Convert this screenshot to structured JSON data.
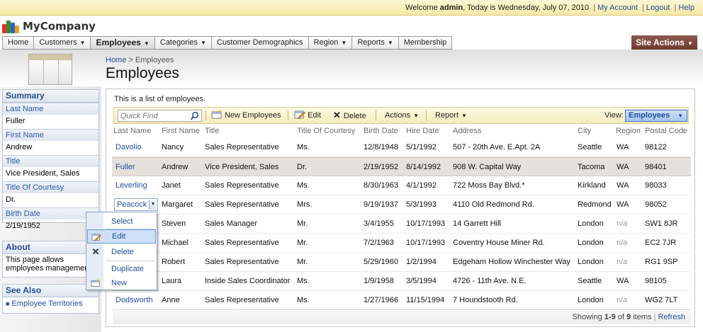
{
  "topbar": {
    "welcome_prefix": "Welcome",
    "user": "admin",
    "today_text": ", Today is Wednesday, July 07, 2010",
    "my_account": "My Account",
    "logout": "Logout",
    "help": "Help"
  },
  "brand": {
    "name": "MyCompany"
  },
  "menu": {
    "items": [
      {
        "label": "Home"
      },
      {
        "label": "Customers"
      },
      {
        "label": "Employees"
      },
      {
        "label": "Categories"
      },
      {
        "label": "Customer Demographics"
      },
      {
        "label": "Region"
      },
      {
        "label": "Reports"
      },
      {
        "label": "Membership"
      }
    ],
    "site_actions": "Site Actions"
  },
  "breadcrumb": {
    "home": "Home",
    "separator": ">",
    "current": "Employees"
  },
  "page": {
    "title": "Employees",
    "description": "This is a list of employees."
  },
  "summary": {
    "title": "Summary",
    "fields": [
      {
        "label": "Last Name",
        "value": "Fuller"
      },
      {
        "label": "First Name",
        "value": "Andrew"
      },
      {
        "label": "Title",
        "value": "Vice President, Sales"
      },
      {
        "label": "Title Of Courtesy",
        "value": "Dr."
      },
      {
        "label": "Birth Date",
        "value": "2/19/1952"
      }
    ]
  },
  "about": {
    "title": "About",
    "text1": "This page allows",
    "text2": "employees management"
  },
  "see_also": {
    "title": "See Also",
    "link": "Employee Territories"
  },
  "toolbar": {
    "quick_find_placeholder": "Quick Find",
    "new_label": "New Employees",
    "edit_label": "Edit",
    "delete_label": "Delete",
    "actions_label": "Actions",
    "report_label": "Report",
    "view_label": "View:",
    "view_value": "Employees"
  },
  "grid": {
    "columns": [
      "Last Name",
      "First Name",
      "Title",
      "Title Of Courtesy",
      "Birth Date",
      "Hire Date",
      "Address",
      "City",
      "Region",
      "Postal Code"
    ],
    "rows": [
      [
        "Davolio",
        "Nancy",
        "Sales Representative",
        "Ms.",
        "12/8/1948",
        "5/1/1992",
        "507 - 20th Ave. E.Apt. 2A",
        "Seattle",
        "WA",
        "98122"
      ],
      [
        "Fuller",
        "Andrew",
        "Vice President, Sales",
        "Dr.",
        "2/19/1952",
        "8/14/1992",
        "908 W. Capital Way",
        "Tacoma",
        "WA",
        "98401"
      ],
      [
        "Leverling",
        "Janet",
        "Sales Representative",
        "Ms.",
        "8/30/1963",
        "4/1/1992",
        "722 Moss Bay Blvd.*",
        "Kirkland",
        "WA",
        "98033"
      ],
      [
        "Peacock",
        "Margaret",
        "Sales Representative",
        "Mrs.",
        "9/19/1937",
        "5/3/1993",
        "4110 Old Redmond Rd.",
        "Redmond",
        "WA",
        "98052"
      ],
      [
        "",
        "Steven",
        "Sales Manager",
        "Mr.",
        "3/4/1955",
        "10/17/1993",
        "14 Garrett Hill",
        "London",
        "n/a",
        "SW1 8JR"
      ],
      [
        "",
        "Michael",
        "Sales Representative",
        "Mr.",
        "7/2/1963",
        "10/17/1993",
        "Coventry House Miner Rd.",
        "London",
        "n/a",
        "EC2 7JR"
      ],
      [
        "",
        "Robert",
        "Sales Representative",
        "Mr.",
        "5/29/1960",
        "1/2/1994",
        "Edgeham Hollow Winchester Way",
        "London",
        "n/a",
        "RG1 9SP"
      ],
      [
        "",
        "Laura",
        "Inside Sales Coordinator",
        "Ms.",
        "1/9/1958",
        "3/5/1994",
        "4726 - 11th Ave. N.E.",
        "Seattle",
        "WA",
        "98105"
      ],
      [
        "Dodsworth",
        "Anne",
        "Sales Representative",
        "Ms.",
        "1/27/1966",
        "11/15/1994",
        "7 Houndstooth Rd.",
        "London",
        "n/a",
        "WG2 7LT"
      ]
    ]
  },
  "pager": {
    "prefix": "Showing",
    "range": "1-9",
    "of": "of",
    "total": "9",
    "suffix": "items",
    "separator": "|",
    "refresh": "Refresh"
  },
  "context_menu": {
    "items": [
      {
        "label": "Select"
      },
      {
        "label": "Edit"
      },
      {
        "label": "Delete"
      },
      {
        "label": "Duplicate"
      },
      {
        "label": "New"
      }
    ]
  }
}
